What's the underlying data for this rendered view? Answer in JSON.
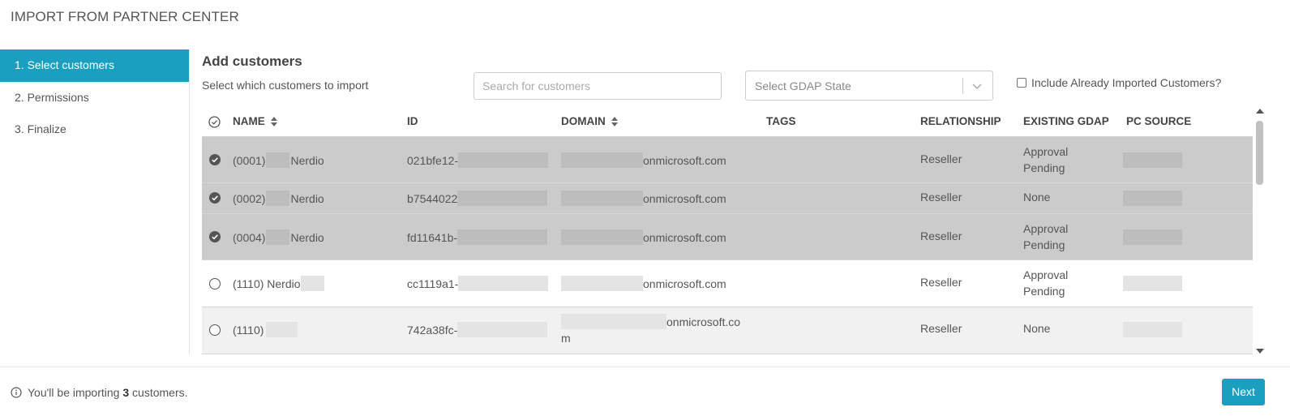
{
  "title": "IMPORT FROM PARTNER CENTER",
  "steps": [
    {
      "label": "1. Select customers"
    },
    {
      "label": "2. Permissions"
    },
    {
      "label": "3. Finalize"
    }
  ],
  "heading": "Add customers",
  "subheading": "Select which customers to import",
  "search": {
    "placeholder": "Search for customers"
  },
  "gdap_select": {
    "placeholder": "Select GDAP State"
  },
  "include_label": "Include Already Imported Customers?",
  "columns": {
    "name": "NAME",
    "id": "ID",
    "domain": "DOMAIN",
    "tags": "TAGS",
    "relationship": "RELATIONSHIP",
    "existing_gdap": "EXISTING GDAP",
    "pc_source": "PC SOURCE"
  },
  "rows": [
    {
      "selected": true,
      "name_prefix": "(0001)",
      "name_suffix": "Nerdio",
      "id": "021bfe12-",
      "domain": "onmicrosoft.com",
      "relationship": "Reseller",
      "gdap": "Approval Pending"
    },
    {
      "selected": true,
      "name_prefix": "(0002)",
      "name_suffix": "Nerdio",
      "id": "b7544022",
      "domain": "onmicrosoft.com",
      "relationship": "Reseller",
      "gdap": "None"
    },
    {
      "selected": true,
      "name_prefix": "(0004)",
      "name_suffix": "Nerdio",
      "id": "fd11641b-",
      "domain": "onmicrosoft.com",
      "relationship": "Reseller",
      "gdap": "Approval Pending"
    },
    {
      "selected": false,
      "name_prefix": "(1110) Nerdio",
      "name_suffix": "",
      "id": "cc1119a1-",
      "domain": "onmicrosoft.com",
      "relationship": "Reseller",
      "gdap": "Approval Pending"
    },
    {
      "selected": false,
      "name_prefix": "(1110)",
      "name_suffix": "",
      "id": "742a38fc-",
      "domain": "onmicrosoft.com",
      "relationship": "Reseller",
      "gdap": "None"
    }
  ],
  "footer": {
    "prefix": "You'll be importing ",
    "count": "3",
    "suffix": " customers.",
    "next_label": "Next"
  },
  "colors": {
    "accent": "#1a9fc0",
    "selected_row": "#cbcbcb"
  }
}
